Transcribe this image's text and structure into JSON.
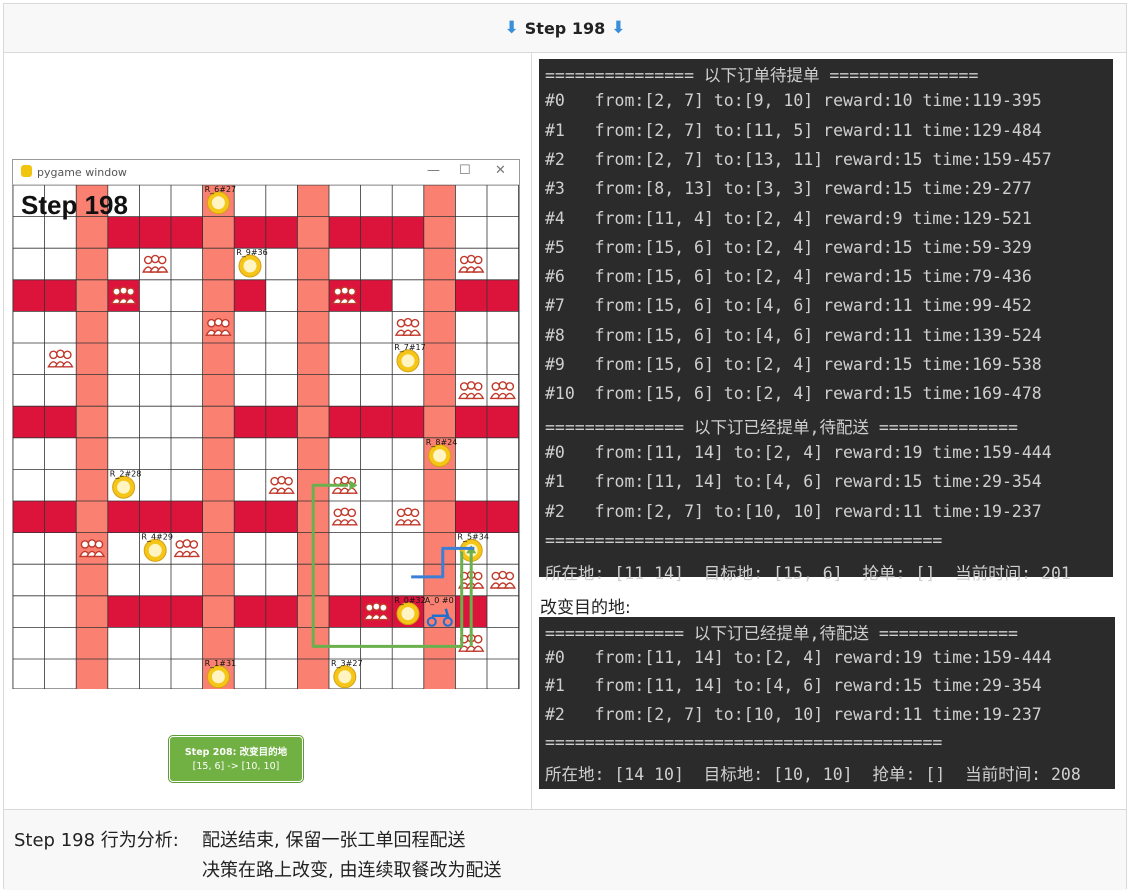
{
  "header": {
    "title": "Step 198",
    "arrow_left": "⬇",
    "arrow_right": "⬇"
  },
  "pygame": {
    "window_title": "pygame window",
    "step_label": "Step 198",
    "callout_line1": "Step 208: 改变目的地",
    "callout_line2": "[15, 6] -> [10, 10]",
    "labels": [
      {
        "text": "R_6#27"
      },
      {
        "text": "R_9#36"
      },
      {
        "text": "R_7#17"
      },
      {
        "text": "R_8#24"
      },
      {
        "text": "R_2#28"
      },
      {
        "text": "R_4#29"
      },
      {
        "text": "R_5#34"
      },
      {
        "text": "R_0#32"
      },
      {
        "text": "A_0 #0"
      },
      {
        "text": "R_1#31"
      },
      {
        "text": "R_3#27"
      }
    ]
  },
  "terminal1": {
    "lines": [
      "=============== 以下订单待提单 ===============",
      "#0   from:[2, 7] to:[9, 10] reward:10 time:119-395",
      "#1   from:[2, 7] to:[11, 5] reward:11 time:129-484",
      "#2   from:[2, 7] to:[13, 11] reward:15 time:159-457",
      "#3   from:[8, 13] to:[3, 3] reward:15 time:29-277",
      "#4   from:[11, 4] to:[2, 4] reward:9 time:129-521",
      "#5   from:[15, 6] to:[2, 4] reward:15 time:59-329",
      "#6   from:[15, 6] to:[2, 4] reward:15 time:79-436",
      "#7   from:[15, 6] to:[4, 6] reward:11 time:99-452",
      "#8   from:[15, 6] to:[4, 6] reward:11 time:139-524",
      "#9   from:[15, 6] to:[2, 4] reward:15 time:169-538",
      "#10  from:[15, 6] to:[2, 4] reward:15 time:169-478",
      "============== 以下订已经提单,待配送 ==============",
      "#0   from:[11, 14] to:[2, 4] reward:19 time:159-444",
      "#1   from:[11, 14] to:[4, 6] reward:15 time:29-354",
      "#2   from:[2, 7] to:[10, 10] reward:11 time:19-237",
      "========================================",
      "所在地: [11 14]  目标地: [15, 6]  抢单: []  当前时间: 201"
    ]
  },
  "changed_label": "改变目的地:",
  "terminal2": {
    "lines": [
      "============== 以下订已经提单,待配送 ==============",
      "#0   from:[11, 14] to:[2, 4] reward:19 time:159-444",
      "#1   from:[11, 14] to:[4, 6] reward:15 time:29-354",
      "#2   from:[2, 7] to:[10, 10] reward:11 time:19-237",
      "========================================",
      "所在地: [14 10]  目标地: [10, 10]  抢单: []  当前时间: 208"
    ]
  },
  "footer": {
    "label": "Step 198 行为分析:",
    "line1": "配送结束, 保留一张工单回程配送",
    "line2": "决策在路上改变, 由连续取餐改为配送"
  },
  "colors": {
    "road_dark": "#dc143c",
    "road_light": "#fa8072",
    "route": "#6ab04c",
    "route_blue": "#3a7fd5"
  }
}
